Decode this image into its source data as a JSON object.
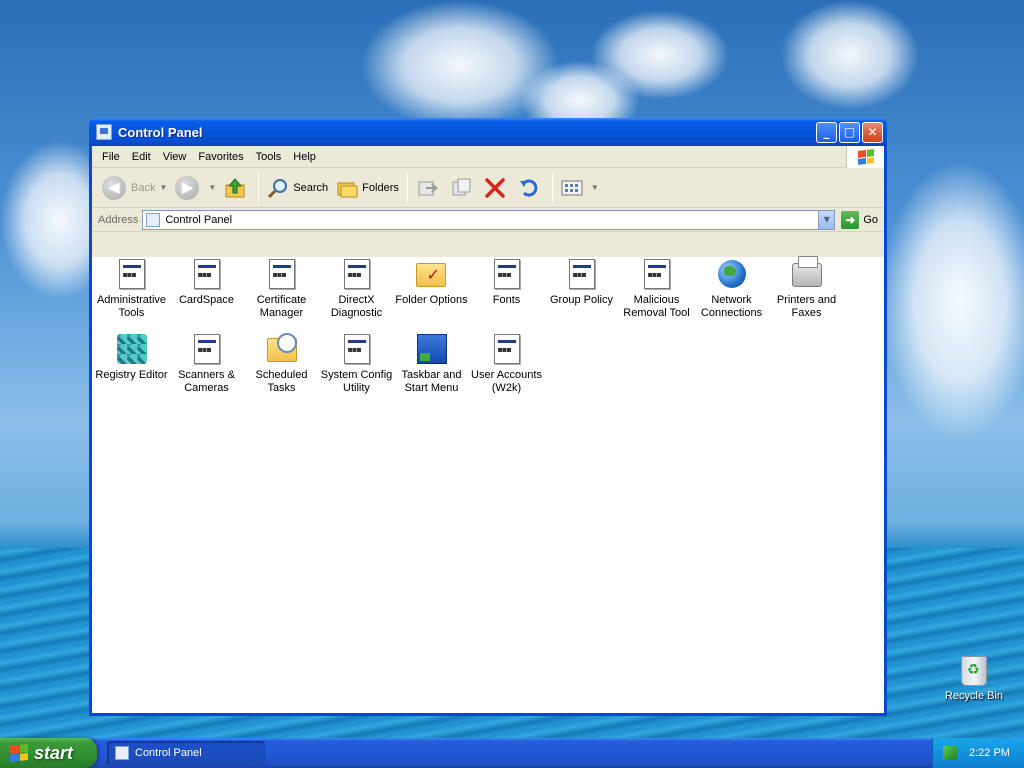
{
  "window": {
    "title": "Control Panel",
    "controls": {
      "minimize": "_",
      "maximize": "□",
      "close": "✕"
    }
  },
  "menu": [
    "File",
    "Edit",
    "View",
    "Favorites",
    "Tools",
    "Help"
  ],
  "toolbar": {
    "back": "Back",
    "search": "Search",
    "folders": "Folders"
  },
  "address": {
    "label": "Address",
    "value": "Control Panel",
    "go": "Go"
  },
  "items": [
    {
      "label": "Administrative Tools",
      "icon": "applet"
    },
    {
      "label": "CardSpace",
      "icon": "applet"
    },
    {
      "label": "Certificate Manager",
      "icon": "applet"
    },
    {
      "label": "DirectX Diagnostic",
      "icon": "applet"
    },
    {
      "label": "Folder Options",
      "icon": "folder-options"
    },
    {
      "label": "Fonts",
      "icon": "applet"
    },
    {
      "label": "Group Policy",
      "icon": "applet"
    },
    {
      "label": "Malicious Removal Tool",
      "icon": "applet"
    },
    {
      "label": "Network Connections",
      "icon": "globe"
    },
    {
      "label": "Printers and Faxes",
      "icon": "printer"
    },
    {
      "label": "Registry Editor",
      "icon": "cubes"
    },
    {
      "label": "Scanners & Cameras",
      "icon": "applet"
    },
    {
      "label": "Scheduled Tasks",
      "icon": "scheduled"
    },
    {
      "label": "System Config Utility",
      "icon": "applet"
    },
    {
      "label": "Taskbar and Start Menu",
      "icon": "taskbar"
    },
    {
      "label": "User Accounts (W2k)",
      "icon": "applet"
    }
  ],
  "desktop": {
    "recycle_bin": "Recycle Bin"
  },
  "taskbar": {
    "start": "start",
    "task": "Control Panel",
    "clock": "2:22 PM"
  },
  "colors": {
    "title_blue": "#0653d8",
    "start_green": "#3c9a3c",
    "tray_blue": "#1290dc",
    "close_red": "#c9421c"
  }
}
